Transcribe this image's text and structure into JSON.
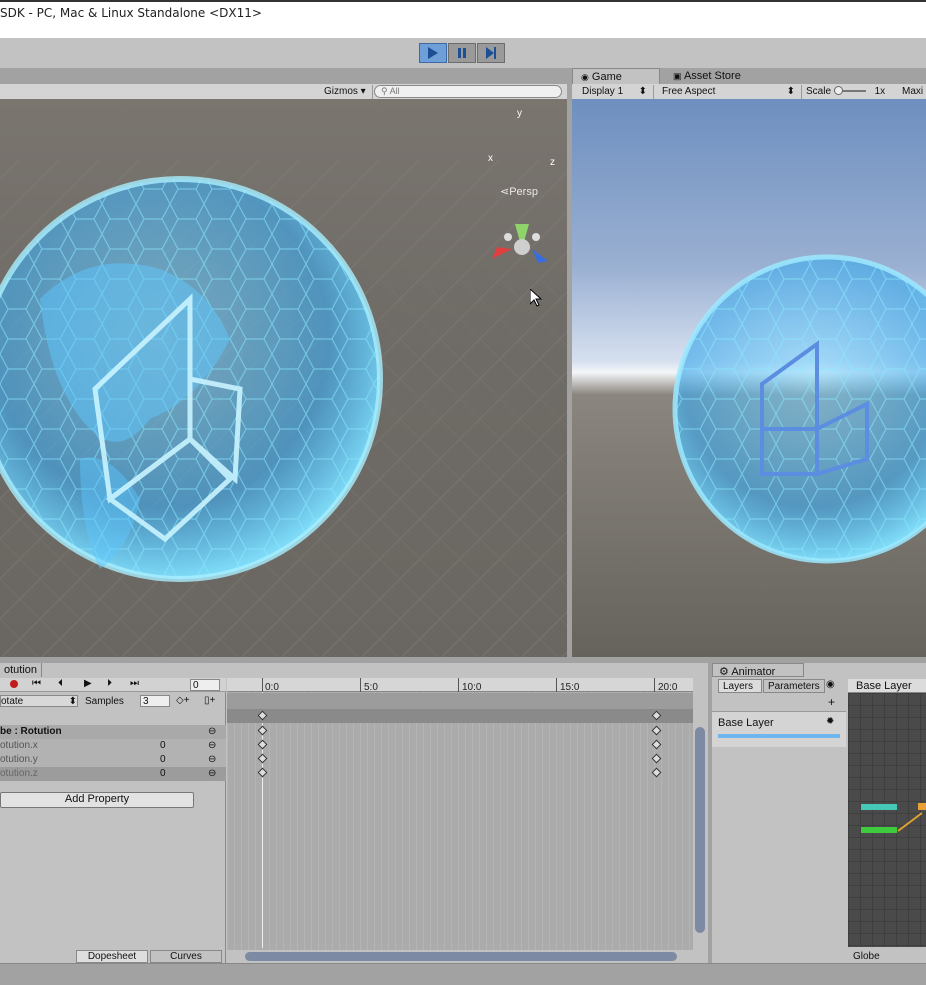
{
  "window": {
    "title": "SDK - PC, Mac & Linux Standalone <DX11>"
  },
  "playbar": {
    "play_icon": "play-icon",
    "pause_icon": "pause-icon",
    "step_icon": "step-icon"
  },
  "scene_view": {
    "gizmos_label": "Gizmos",
    "search_placeholder": "All",
    "persp_label": "Persp",
    "axis_y": "y",
    "axis_x": "x",
    "axis_z": "z"
  },
  "tabs": {
    "game": "Game",
    "asset_store": "Asset Store"
  },
  "game_view": {
    "display": "Display 1",
    "aspect": "Free Aspect",
    "scale_label": "Scale",
    "scale_value": "1x",
    "maximize": "Maxi"
  },
  "animation": {
    "tab_label": "otution",
    "frame_value": "0",
    "mode_label": "otate",
    "samples_label": "Samples",
    "samples_value": "3",
    "ticks": [
      "0:0",
      "5:0",
      "10:0",
      "15:0",
      "20:0"
    ],
    "properties": [
      {
        "name": "be : Rotution",
        "value": ""
      },
      {
        "name": "otution.x",
        "value": "0"
      },
      {
        "name": "otution.y",
        "value": "0"
      },
      {
        "name": "otution.z",
        "value": "0"
      }
    ],
    "add_property": "Add Property",
    "dopesheet": "Dopesheet",
    "curves": "Curves"
  },
  "animator": {
    "tab_label": "Animator",
    "layers_tab": "Layers",
    "parameters_tab": "Parameters",
    "base_layer_header": "Base Layer",
    "base_layer_item": "Base Layer",
    "footer_label": "Globe",
    "add_icon": "plus-icon"
  },
  "colors": {
    "hologram": "#4fc3ff",
    "selection": "#3e7ddb",
    "active_state": "#3ecb3e",
    "entry_state": "#46c7b8"
  }
}
